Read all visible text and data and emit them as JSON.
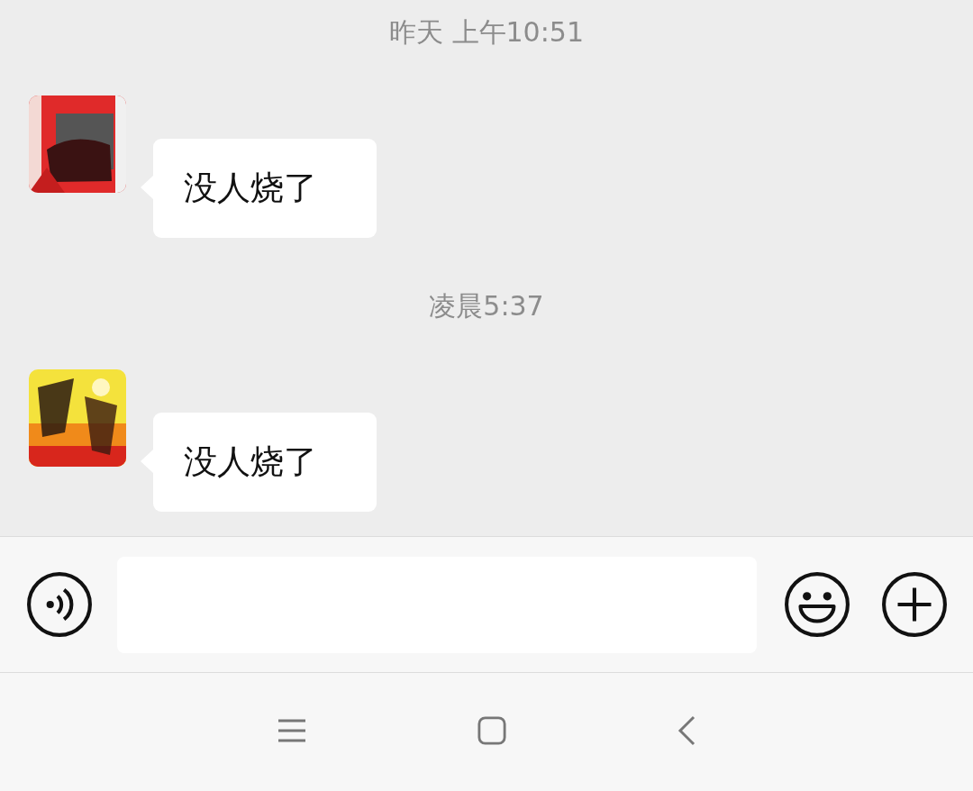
{
  "chat": [
    {
      "kind": "time",
      "text": "昨天 上午10:51"
    },
    {
      "kind": "message",
      "text": "没人烧了"
    },
    {
      "kind": "time",
      "text": "凌晨5:37"
    },
    {
      "kind": "message",
      "text": "没人烧了"
    }
  ]
}
